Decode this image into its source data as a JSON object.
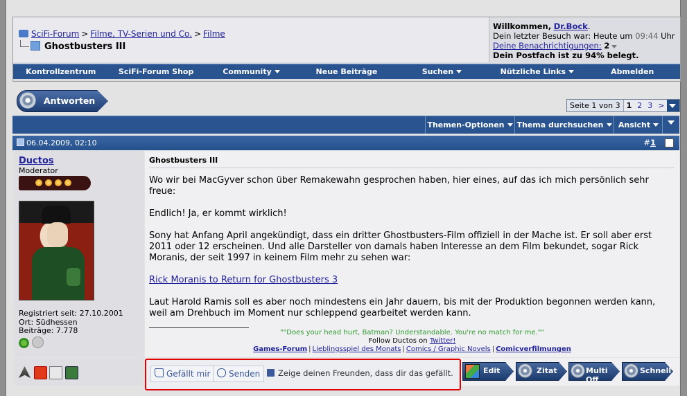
{
  "breadcrumb": {
    "items": [
      "SciFi-Forum",
      "Filme, TV-Serien und Co.",
      "Filme"
    ],
    "separator": ">",
    "current": "Ghostbusters III"
  },
  "welcome": {
    "greeting": "Willkommen,",
    "user": "Dr.Bock",
    "last_visit_prefix": "Dein letzter Besuch war: Heute um",
    "last_visit_time": "09:44",
    "last_visit_suffix": "Uhr",
    "notifications_label": "Deine Benachrichtigungen:",
    "notifications_count": "2",
    "mailbox": "Dein Postfach ist zu 94% belegt."
  },
  "navbar": [
    "Kontrollzentrum",
    "SciFi-Forum Shop",
    "Community",
    "Neue Beiträge",
    "Suchen",
    "Nützliche Links",
    "Abmelden"
  ],
  "reply_button": "Antworten",
  "pagination": {
    "label": "Seite 1 von 3",
    "current": "1",
    "pages": [
      "2",
      "3"
    ],
    "next": ">"
  },
  "thread_tools": [
    "Themen-Optionen",
    "Thema durchsuchen",
    "Ansicht"
  ],
  "post": {
    "date": "06.04.2009, 02:10",
    "number_prefix": "#",
    "number": "1",
    "title": "Ghostbusters III",
    "paragraphs": [
      "Wo wir bei MacGyver schon über Remakewahn gesprochen haben, hier eines, auf das ich mich persönlich sehr freue:",
      "Endlich! Ja, er kommt wirklich!",
      "Sony hat Anfang April angekündigt, dass ein dritter Ghostbusters-Film offiziell in der Mache ist. Er soll aber erst 2011 oder 12 erscheinen. Und alle Darsteller von damals haben Interesse an dem Film bekundet, sogar Rick Moranis, der seit 1997 in keinem Film mehr zu sehen war:"
    ],
    "link": "Rick Moranis to Return for Ghostbusters 3",
    "last_paragraph": "Laut Harold Ramis soll es aber noch mindestens ein Jahr dauern, bis mit der Produktion begonnen werden kann, weil am Drehbuch im Moment nur schleppend gearbeitet werden kann."
  },
  "signature": {
    "quote": "\"\"Does your head hurt, Batman? Understandable. You're no match for me.\"\"",
    "follow_prefix": "Follow Ductos on",
    "follow_link": "Twitter!",
    "links": [
      "Games-Forum",
      "Lieblingsspiel des Monats",
      "Comics / Graphic Novels",
      "Comicverfilmungen"
    ]
  },
  "user": {
    "name": "Ductos",
    "rank": "Moderator",
    "rank_level": 4,
    "registered": "Registriert seit: 27.10.2001",
    "location": "Ort: Südhessen",
    "posts": "Beiträge: 7.778"
  },
  "facebook": {
    "like": "Gefällt mir",
    "send": "Senden",
    "text": "Zeige deinen Freunden, dass dir das gefällt."
  },
  "post_buttons": [
    "Edit",
    "Zitat",
    "Multi Off",
    "Schnell"
  ],
  "colors": {
    "navbar": "#2a5490",
    "link": "#22229c",
    "highlight_border": "#e00000",
    "signature_quote": "#2f9a2f"
  }
}
